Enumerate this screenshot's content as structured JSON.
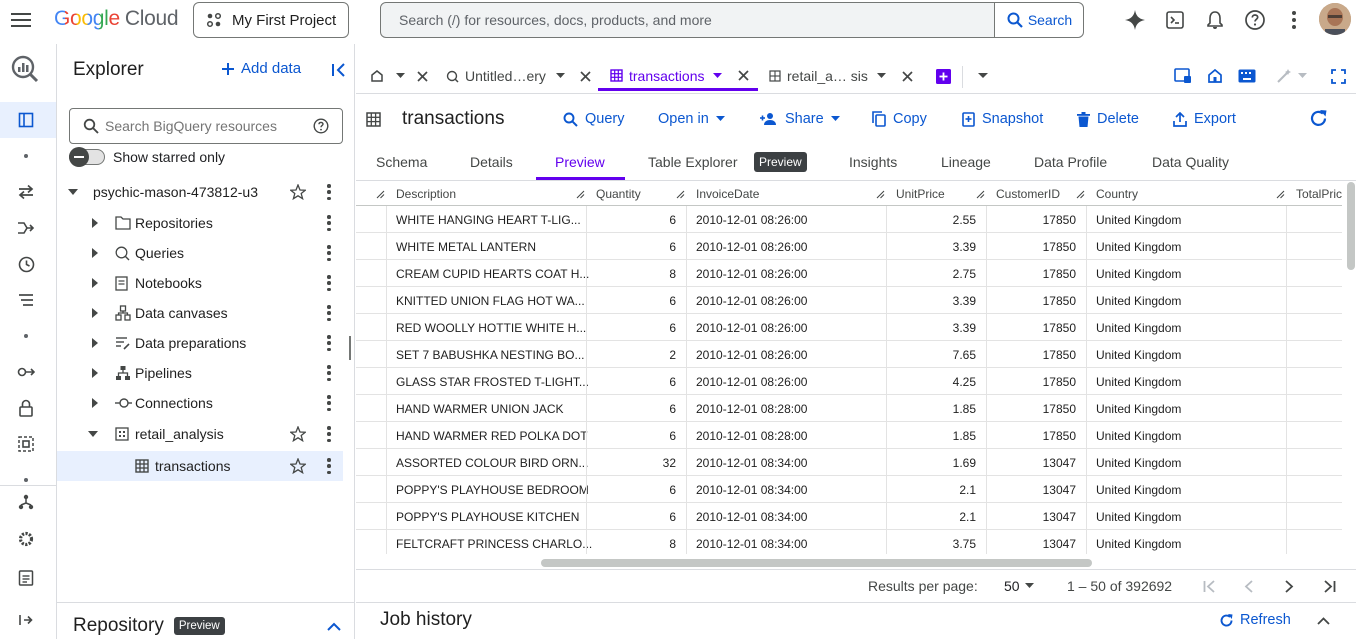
{
  "topbar": {
    "logo_google": "Google",
    "logo_cloud": "Cloud",
    "project": "My First Project",
    "search_placeholder": "Search (/) for resources, docs, products, and more",
    "search_button": "Search"
  },
  "explorer": {
    "title": "Explorer",
    "add_data": "Add data",
    "search_placeholder": "Search BigQuery resources",
    "starred_only": "Show starred only",
    "project_name": "psychic-mason-473812-u3",
    "items": [
      "Repositories",
      "Queries",
      "Notebooks",
      "Data canvases",
      "Data preparations",
      "Pipelines",
      "Connections"
    ],
    "dataset": "retail_analysis",
    "table": "transactions"
  },
  "repository": {
    "title": "Repository",
    "badge": "Preview"
  },
  "tabs": {
    "untitled": "Untitled…ery",
    "transactions": "transactions",
    "retail": "retail_a… sis"
  },
  "table_header": {
    "name": "transactions",
    "query": "Query",
    "open_in": "Open in",
    "share": "Share",
    "copy": "Copy",
    "snapshot": "Snapshot",
    "delete": "Delete",
    "export": "Export"
  },
  "subtabs": {
    "schema": "Schema",
    "details": "Details",
    "preview": "Preview",
    "table_explorer": "Table Explorer",
    "table_explorer_badge": "Preview",
    "insights": "Insights",
    "lineage": "Lineage",
    "data_profile": "Data Profile",
    "data_quality": "Data Quality"
  },
  "columns": [
    "Description",
    "Quantity",
    "InvoiceDate",
    "UnitPrice",
    "CustomerID",
    "Country",
    "TotalPric"
  ],
  "rows": [
    [
      "WHITE HANGING HEART T-LIG...",
      "6",
      "2010-12-01 08:26:00",
      "2.55",
      "17850",
      "United Kingdom"
    ],
    [
      "WHITE METAL LANTERN",
      "6",
      "2010-12-01 08:26:00",
      "3.39",
      "17850",
      "United Kingdom"
    ],
    [
      "CREAM CUPID HEARTS COAT H...",
      "8",
      "2010-12-01 08:26:00",
      "2.75",
      "17850",
      "United Kingdom"
    ],
    [
      "KNITTED UNION FLAG HOT WA...",
      "6",
      "2010-12-01 08:26:00",
      "3.39",
      "17850",
      "United Kingdom"
    ],
    [
      "RED WOOLLY HOTTIE WHITE H...",
      "6",
      "2010-12-01 08:26:00",
      "3.39",
      "17850",
      "United Kingdom"
    ],
    [
      "SET 7 BABUSHKA NESTING BO...",
      "2",
      "2010-12-01 08:26:00",
      "7.65",
      "17850",
      "United Kingdom"
    ],
    [
      "GLASS STAR FROSTED T-LIGHT...",
      "6",
      "2010-12-01 08:26:00",
      "4.25",
      "17850",
      "United Kingdom"
    ],
    [
      "HAND WARMER UNION JACK",
      "6",
      "2010-12-01 08:28:00",
      "1.85",
      "17850",
      "United Kingdom"
    ],
    [
      "HAND WARMER RED POLKA DOT",
      "6",
      "2010-12-01 08:28:00",
      "1.85",
      "17850",
      "United Kingdom"
    ],
    [
      "ASSORTED COLOUR BIRD ORN...",
      "32",
      "2010-12-01 08:34:00",
      "1.69",
      "13047",
      "United Kingdom"
    ],
    [
      "POPPY'S PLAYHOUSE BEDROOM",
      "6",
      "2010-12-01 08:34:00",
      "2.1",
      "13047",
      "United Kingdom"
    ],
    [
      "POPPY'S PLAYHOUSE KITCHEN",
      "6",
      "2010-12-01 08:34:00",
      "2.1",
      "13047",
      "United Kingdom"
    ],
    [
      "FELTCRAFT PRINCESS CHARLO...",
      "8",
      "2010-12-01 08:34:00",
      "3.75",
      "13047",
      "United Kingdom"
    ]
  ],
  "pagination": {
    "results_label": "Results per page:",
    "per_page": "50",
    "range": "1 – 50 of 392692"
  },
  "job_history": {
    "title": "Job history",
    "refresh": "Refresh"
  },
  "colors": {
    "accent": "#0b57d0",
    "active_tab": "#6200ee",
    "purple": "#8430ce"
  }
}
